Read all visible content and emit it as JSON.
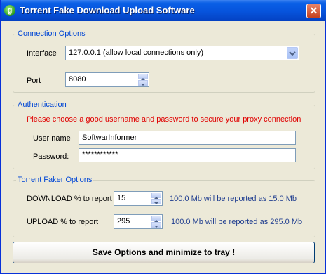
{
  "window": {
    "title": "Torrent Fake Download Upload Software",
    "app_icon_glyph": "g",
    "close_glyph": "✕"
  },
  "connection": {
    "legend": "Connection Options",
    "interface_label": "Interface",
    "interface_value": "127.0.0.1 (allow local connections only)",
    "port_label": "Port",
    "port_value": "8080"
  },
  "auth": {
    "legend": "Authentication",
    "notice": "Please choose a good username and password to secure your proxy connection",
    "username_label": "User name",
    "username_value": "SoftwarInformer",
    "password_label": "Password:",
    "password_value": "************"
  },
  "faker": {
    "legend": "Torrent Faker Options",
    "download_label": "DOWNLOAD % to report",
    "download_value": "15",
    "download_info": "100.0 Mb will be reported as 15.0 Mb",
    "upload_label": "UPLOAD % to report",
    "upload_value": "295",
    "upload_info": "100.0 Mb will be reported as 295.0 Mb"
  },
  "actions": {
    "save_label": "Save Options and minimize to tray !"
  },
  "colors": {
    "titlebar": "#0653dc",
    "legend": "#0046d5",
    "notice": "#e00000",
    "info": "#1f3d8f"
  }
}
